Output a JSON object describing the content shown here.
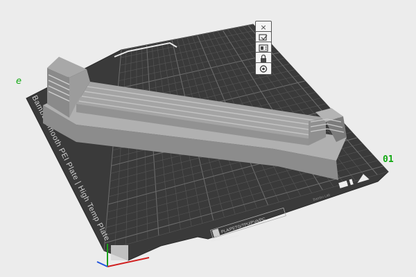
{
  "plate": {
    "number": "01",
    "corner_mark": "e",
    "plate_text": "Bambu Smooth PEI Plate | High Temp Plate",
    "nameplate_text": "PLA/PETG/TPU/PVA/PC",
    "nameplate_small": "Bambu Lab"
  },
  "plate_toolbar": {
    "items": [
      {
        "name": "remove-plate-icon",
        "glyph": "×"
      },
      {
        "name": "auto-orient-icon",
        "glyph": ""
      },
      {
        "name": "arrange-icon",
        "glyph": ""
      },
      {
        "name": "lock-icon",
        "glyph": ""
      },
      {
        "name": "settings-icon",
        "glyph": ""
      }
    ]
  },
  "colors": {
    "background": "#ececec",
    "plate": "#3a3a3a",
    "grid": "#5a5a5a",
    "grid_major": "#6e6e6e",
    "model_top": "#a9a9a9",
    "model_front": "#8e8e8e",
    "model_side": "#7a7a7a",
    "accent_green": "#11a811"
  }
}
